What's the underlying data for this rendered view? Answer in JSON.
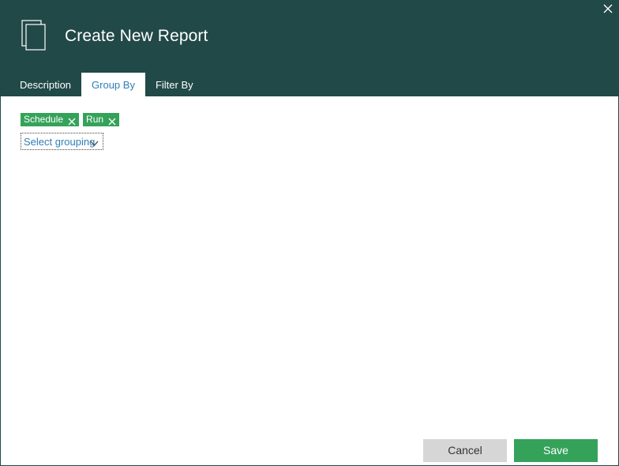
{
  "dialog": {
    "title": "Create New Report"
  },
  "tabs": [
    {
      "label": "Description",
      "active": false
    },
    {
      "label": "Group By",
      "active": true
    },
    {
      "label": "Filter By",
      "active": false
    }
  ],
  "group_by": {
    "chips": [
      {
        "label": "Schedule"
      },
      {
        "label": "Run"
      }
    ],
    "select_placeholder": "Select grouping"
  },
  "footer": {
    "cancel_label": "Cancel",
    "save_label": "Save"
  },
  "colors": {
    "header_bg": "#214948",
    "accent_green": "#35a25a",
    "link_blue": "#2f7fb3",
    "cancel_bg": "#d6d6d6"
  },
  "icons": {
    "close": "close-icon",
    "report": "report-document-icon",
    "chip_remove": "remove-icon",
    "dropdown": "chevron-down-icon"
  }
}
